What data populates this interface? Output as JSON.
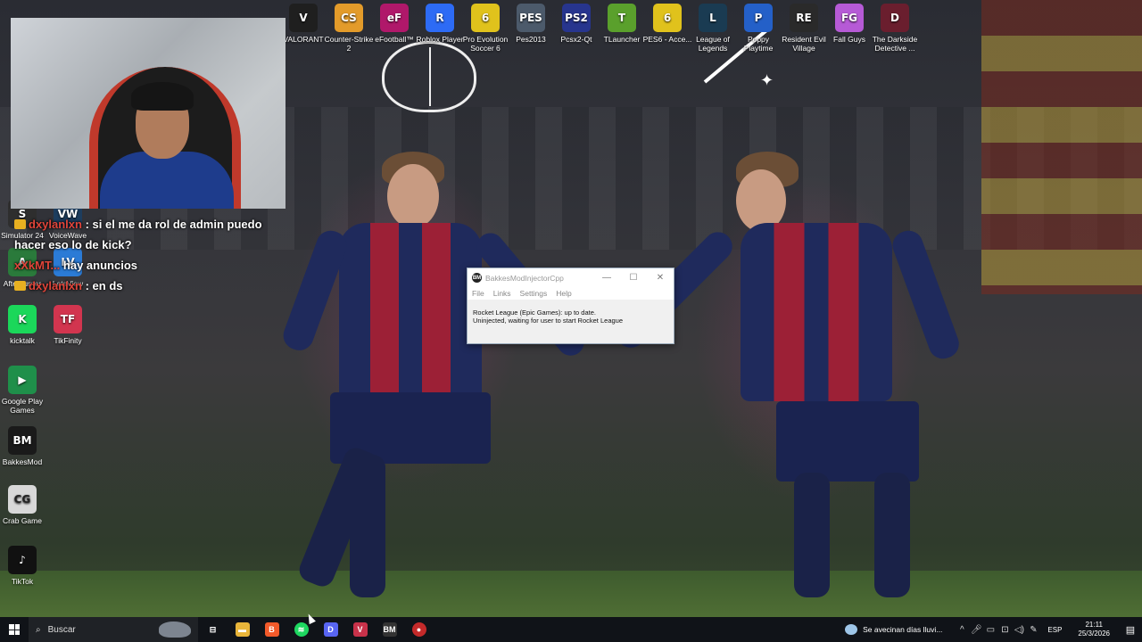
{
  "desktop_icons_top": [
    {
      "label": "VALORANT",
      "color": "#1f1f1f",
      "glyph": "V",
      "icon": "valorant-icon"
    },
    {
      "label": "Counter-Strike 2",
      "color": "#e39b2a",
      "glyph": "CS",
      "icon": "counter-strike-icon"
    },
    {
      "label": "eFootball™",
      "color": "#b0186a",
      "glyph": "eF",
      "icon": "efootball-icon"
    },
    {
      "label": "Roblox Player",
      "color": "#2d6bf5",
      "glyph": "R",
      "icon": "roblox-icon"
    },
    {
      "label": "Pro Evolution Soccer 6",
      "color": "#e0c21c",
      "glyph": "6",
      "icon": "pes6-icon"
    },
    {
      "label": "Pes2013",
      "color": "#4c5a6b",
      "glyph": "PES",
      "icon": "pes2013-icon"
    },
    {
      "label": "Pcsx2-Qt",
      "color": "#27358e",
      "glyph": "PS2",
      "icon": "pcsx2-icon"
    },
    {
      "label": "TLauncher",
      "color": "#5aa02c",
      "glyph": "T",
      "icon": "tlauncher-icon"
    },
    {
      "label": "PES6 - Acce...",
      "color": "#e0c21c",
      "glyph": "6",
      "icon": "pes6-access-icon"
    },
    {
      "label": "League of Legends",
      "color": "#1a3b52",
      "glyph": "L",
      "icon": "league-of-legends-icon"
    },
    {
      "label": "Poppy Playtime",
      "color": "#2460c8",
      "glyph": "P",
      "icon": "poppy-playtime-icon"
    },
    {
      "label": "Resident Evil Village",
      "color": "#2a2a2a",
      "glyph": "RE",
      "icon": "resident-evil-icon"
    },
    {
      "label": "Fall Guys",
      "color": "#b65ad6",
      "glyph": "FG",
      "icon": "fall-guys-icon"
    },
    {
      "label": "The Darkside Detective ...",
      "color": "#6a1e2e",
      "glyph": "D",
      "icon": "darkside-detective-icon"
    }
  ],
  "desktop_icons_left": [
    {
      "label": "Simulator 24",
      "color": "#2e2e2e",
      "glyph": "S",
      "icon": "simulator-icon"
    },
    {
      "label": "VoiceWave",
      "color": "#1d3d5e",
      "glyph": "VW",
      "icon": "voicewave-icon"
    },
    {
      "label": "Afterburner",
      "color": "#2a7a3b",
      "glyph": "A",
      "icon": "afterburner-icon"
    },
    {
      "label": "LetsView",
      "color": "#2b7bd6",
      "glyph": "LV",
      "icon": "letsview-icon"
    },
    {
      "label": "kicktalk",
      "color": "#1bd75a",
      "glyph": "K",
      "icon": "kicktalk-icon"
    },
    {
      "label": "TikFinity",
      "color": "#d2354f",
      "glyph": "TF",
      "icon": "tikfinity-icon"
    },
    {
      "label": "Google Play Games",
      "color": "#1f8f4a",
      "glyph": "▶",
      "icon": "google-play-games-icon"
    },
    {
      "label": "BakkesMod",
      "color": "#1a1a1a",
      "glyph": "BM",
      "icon": "bakkesmod-icon"
    },
    {
      "label": "Crab Game",
      "color": "#d8d8d8",
      "glyph": "CG",
      "icon": "crab-game-icon"
    },
    {
      "label": "TikTok",
      "color": "#111111",
      "glyph": "♪",
      "icon": "tiktok-icon"
    }
  ],
  "chat": [
    {
      "user": "dxylanlxn",
      "message": ": si el me da rol de admin puedo hacer eso lo de kick?",
      "badge": true
    },
    {
      "user": "xXkMT...",
      "message": "hay anuncios",
      "badge": false
    },
    {
      "user": "dxylanlxn",
      "message": ": en ds",
      "badge": true
    }
  ],
  "window": {
    "title": "BakkesModInjectorCpp",
    "app_icon_glyph": "BM",
    "menus": [
      "File",
      "Links",
      "Settings",
      "Help"
    ],
    "status_line1": "Rocket League (Epic Games): up to date.",
    "status_line2": "Uninjected, waiting for user to start Rocket League",
    "minimize_glyph": "—",
    "maximize_glyph": "☐",
    "close_glyph": "✕"
  },
  "taskbar": {
    "search_placeholder": "Buscar",
    "apps": [
      {
        "name": "task-view",
        "glyph": "⊟",
        "color": "transparent"
      },
      {
        "name": "file-explorer",
        "glyph": "▬",
        "color": "#e8b53a"
      },
      {
        "name": "brave",
        "glyph": "B",
        "color": "#f25a2a"
      },
      {
        "name": "spotify",
        "glyph": "≋",
        "color": "#1ed760"
      },
      {
        "name": "discord",
        "glyph": "D",
        "color": "#5865f2"
      },
      {
        "name": "voicemod",
        "glyph": "V",
        "color": "#c8324a"
      },
      {
        "name": "bakkesmod",
        "glyph": "BM",
        "color": "#333333"
      },
      {
        "name": "obs",
        "glyph": "●",
        "color": "#c42a2a"
      }
    ],
    "weather_text": "Se avecinan días lluvi...",
    "language": "ESP",
    "time": "21:11",
    "date": "25/3/2026"
  }
}
